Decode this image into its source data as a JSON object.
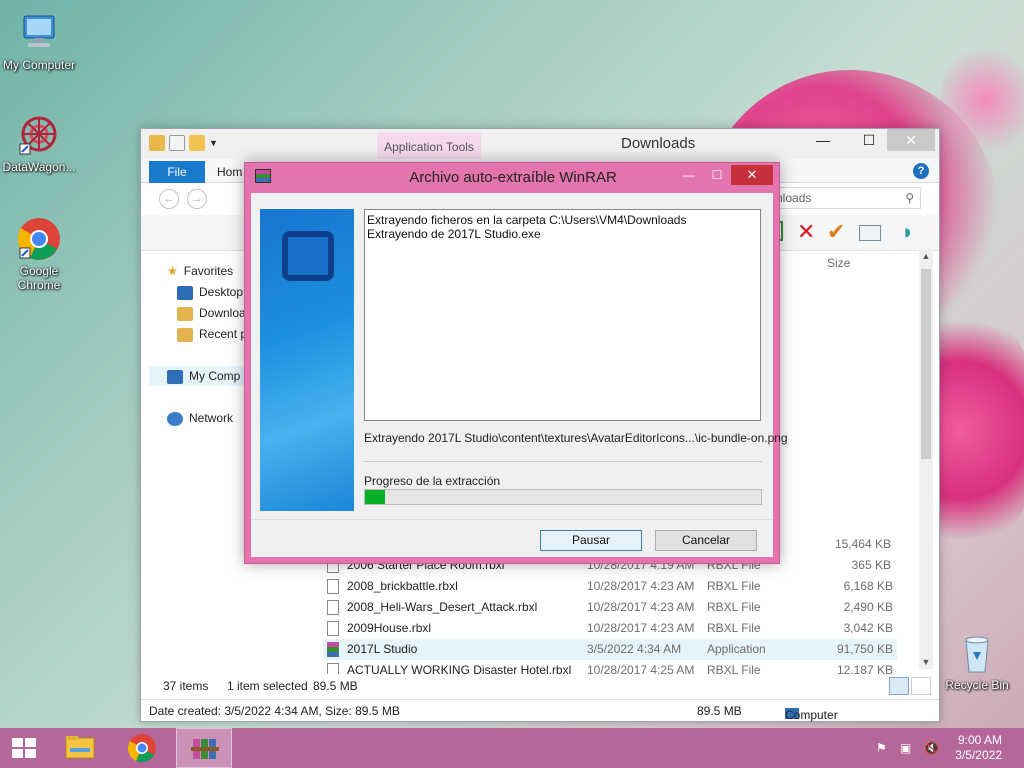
{
  "desktop": {
    "icons": [
      {
        "label": "My Computer",
        "icon": "computer-icon"
      },
      {
        "label": "DataWagon...",
        "icon": "datawagon-icon"
      },
      {
        "label": "Google Chrome",
        "icon": "chrome-icon"
      },
      {
        "label": "Recycle Bin",
        "icon": "recycle-bin-icon"
      }
    ]
  },
  "explorer": {
    "title": "Downloads",
    "context_tab": "Application Tools",
    "tabs": {
      "file": "File",
      "home": "Hom"
    },
    "help": "?",
    "search_placeholder": "nloads",
    "controls": {
      "minimize": "—",
      "maximize": "☐",
      "close": "✕"
    },
    "nav": {
      "favorites": "Favorites",
      "desktop": "Desktop",
      "downloads": "Downloa",
      "recent": "Recent p",
      "computer": "My Comp",
      "network": "Network"
    },
    "column_size": "Size",
    "sizes_above": [
      "15,464 KB",
      "365 KB"
    ],
    "files": [
      {
        "name": "2006 Starter Place Room.rbxl",
        "date": "10/28/2017 4:19 AM",
        "type": "RBXL File",
        "size": "365 KB"
      },
      {
        "name": "2008_brickbattle.rbxl",
        "date": "10/28/2017 4:23 AM",
        "type": "RBXL File",
        "size": "6,168 KB"
      },
      {
        "name": "2008_Heli-Wars_Desert_Attack.rbxl",
        "date": "10/28/2017 4:23 AM",
        "type": "RBXL File",
        "size": "2,490 KB"
      },
      {
        "name": "2009House.rbxl",
        "date": "10/28/2017 4:23 AM",
        "type": "RBXL File",
        "size": "3,042 KB"
      },
      {
        "name": "2017L Studio",
        "date": "3/5/2022 4:34 AM",
        "type": "Application",
        "size": "91,750 KB"
      },
      {
        "name": "ACTUALLY WORKING Disaster Hotel.rbxl",
        "date": "10/28/2017 4:25 AM",
        "type": "RBXL File",
        "size": "12,187 KB"
      }
    ],
    "status": {
      "count": "37 items",
      "selected": "1 item selected",
      "selected_size": "89.5 MB"
    },
    "details": {
      "info": "Date created: 3/5/2022 4:34 AM, Size: 89.5 MB",
      "size": "89.5 MB",
      "location": "Computer"
    }
  },
  "winrar": {
    "title": "Archivo auto-extraíble WinRAR",
    "controls": {
      "minimize": "—",
      "maximize": "☐",
      "close": "✕"
    },
    "log_lines": [
      "Extrayendo ficheros en la carpeta C:\\Users\\VM4\\Downloads",
      "Extrayendo de 2017L Studio.exe"
    ],
    "current_file": "Extrayendo 2017L Studio\\content\\textures\\AvatarEditorIcons...\\ic-bundle-on.png",
    "progress_label": "Progreso de la extracción",
    "progress": 0.05,
    "progress_color": "#06b025",
    "buttons": {
      "pause": "Pausar",
      "cancel": "Cancelar"
    }
  },
  "taskbar": {
    "items": [
      "start-button",
      "file-explorer",
      "chrome",
      "winrar"
    ],
    "clock": {
      "time": "9:00 AM",
      "date": "3/5/2022"
    }
  }
}
